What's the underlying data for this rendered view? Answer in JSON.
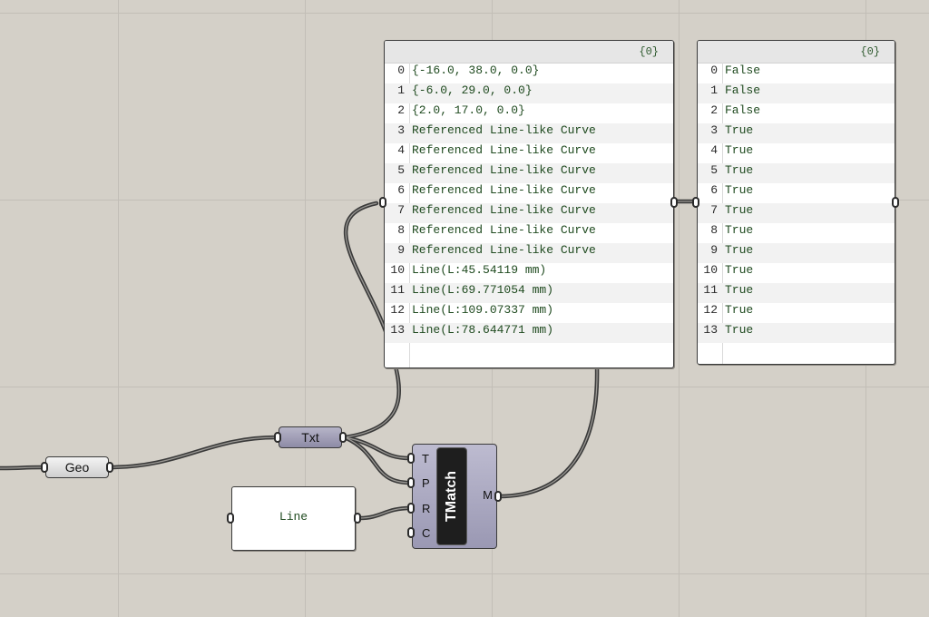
{
  "colors": {
    "canvas": "#d4d0c8",
    "gridline": "#c2beb7",
    "panel_text": "#1f4a1f",
    "wire": "#3a3a3a"
  },
  "panel_data": {
    "path": "{0}",
    "rows": [
      {
        "index": "0",
        "value": "{-16.0, 38.0, 0.0}"
      },
      {
        "index": "1",
        "value": "{-6.0, 29.0, 0.0}"
      },
      {
        "index": "2",
        "value": "{2.0, 17.0, 0.0}"
      },
      {
        "index": "3",
        "value": "Referenced Line-like Curve"
      },
      {
        "index": "4",
        "value": "Referenced Line-like Curve"
      },
      {
        "index": "5",
        "value": "Referenced Line-like Curve"
      },
      {
        "index": "6",
        "value": "Referenced Line-like Curve"
      },
      {
        "index": "7",
        "value": "Referenced Line-like Curve"
      },
      {
        "index": "8",
        "value": "Referenced Line-like Curve"
      },
      {
        "index": "9",
        "value": "Referenced Line-like Curve"
      },
      {
        "index": "10",
        "value": "Line(L:45.54119 mm)"
      },
      {
        "index": "11",
        "value": "Line(L:69.771054 mm)"
      },
      {
        "index": "12",
        "value": "Line(L:109.07337 mm)"
      },
      {
        "index": "13",
        "value": "Line(L:78.644771 mm)"
      }
    ]
  },
  "panel_result": {
    "path": "{0}",
    "rows": [
      {
        "index": "0",
        "value": "False"
      },
      {
        "index": "1",
        "value": "False"
      },
      {
        "index": "2",
        "value": "False"
      },
      {
        "index": "3",
        "value": "True"
      },
      {
        "index": "4",
        "value": "True"
      },
      {
        "index": "5",
        "value": "True"
      },
      {
        "index": "6",
        "value": "True"
      },
      {
        "index": "7",
        "value": "True"
      },
      {
        "index": "8",
        "value": "True"
      },
      {
        "index": "9",
        "value": "True"
      },
      {
        "index": "10",
        "value": "True"
      },
      {
        "index": "11",
        "value": "True"
      },
      {
        "index": "12",
        "value": "True"
      },
      {
        "index": "13",
        "value": "True"
      }
    ]
  },
  "params": {
    "geo": "Geo",
    "txt": "Txt"
  },
  "text_panel": {
    "value": "Line"
  },
  "component": {
    "name": "TMatch",
    "inputs": [
      "T",
      "P",
      "R",
      "C"
    ],
    "output": "M"
  }
}
